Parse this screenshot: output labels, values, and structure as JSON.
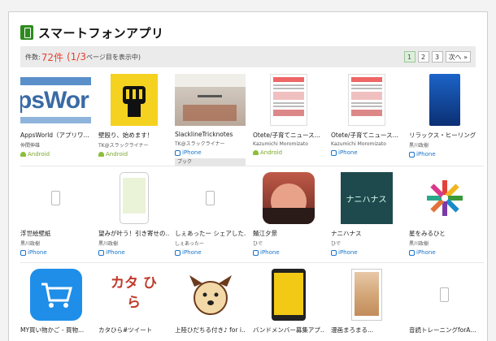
{
  "header": {
    "title": "スマートフォンアプリ"
  },
  "count": {
    "label": "件数:",
    "num": "72件",
    "page": "(1/3",
    "tail": "ページ目を表示中)"
  },
  "pager": [
    "1",
    "2",
    "3",
    "次へ »"
  ],
  "rows": [
    [
      {
        "name": "AppsWorld（アプリワ...",
        "author": "仲間伸雄",
        "platform": "Android",
        "thumb": "AppsWorld"
      },
      {
        "name": "壁殴り、始めます！",
        "author": "TK@スラックライナー",
        "platform": "Android",
        "thumb": "fist"
      },
      {
        "name": "SlacklineTricknotes",
        "author": "TK@スラックライナー",
        "platform": "iPhone",
        "thumb": "gym",
        "tag": "ブック"
      },
      {
        "name": "Otete/子育てニュース...",
        "author": "Kazumichi Moromizato",
        "platform": "Android",
        "thumb": "doc"
      },
      {
        "name": "Otete/子育てニュース...",
        "author": "Kazumichi Moromizato",
        "platform": "iPhone",
        "thumb": "doc"
      },
      {
        "name": "リラックス・ヒーリング",
        "author": "黒川政樹",
        "platform": "iPhone",
        "thumb": "blue"
      }
    ],
    [
      {
        "name": "浮世絵壁紙",
        "author": "黒川政樹",
        "platform": "iPhone",
        "thumb": "placeholder"
      },
      {
        "name": "望みが叶う！引き寄せの...",
        "author": "黒川政樹",
        "platform": "iPhone",
        "thumb": "phone"
      },
      {
        "name": "しぇあったー シェアした...",
        "author": "しぇあったー",
        "platform": "iPhone",
        "thumb": "placeholder"
      },
      {
        "name": "鯖江夕景",
        "author": "ひで",
        "platform": "iPhone",
        "thumb": "sunset"
      },
      {
        "name": "ナニハナス",
        "author": "ひで",
        "platform": "iPhone",
        "thumb": "nani",
        "thumb_text": "ナニハナス"
      },
      {
        "name": "星をみるひと",
        "author": "黒川政樹",
        "platform": "iPhone",
        "thumb": "star"
      }
    ],
    [
      {
        "name": "MY買い物かご - 買物...",
        "author": "",
        "platform": "",
        "thumb": "cart"
      },
      {
        "name": "カタひら#ツイート",
        "author": "",
        "platform": "",
        "thumb": "katahira",
        "thumb_text": "カタ ひら"
      },
      {
        "name": "上陸ひだちる付き♪ for i...",
        "author": "",
        "platform": "",
        "thumb": "dog"
      },
      {
        "name": "バンドメンバー募集アプ...",
        "author": "",
        "platform": "",
        "thumb": "yellowphone"
      },
      {
        "name": "漫画まろまる...",
        "author": "",
        "platform": "",
        "thumb": "comic"
      },
      {
        "name": "音読トレーニングforA...",
        "author": "",
        "platform": "",
        "thumb": "placeholder"
      }
    ]
  ],
  "colors": {
    "accent_red": "#e8422f",
    "brand_green": "#2e8b1f",
    "ios_blue": "#1a73c8",
    "android_green": "#7aa82a"
  }
}
